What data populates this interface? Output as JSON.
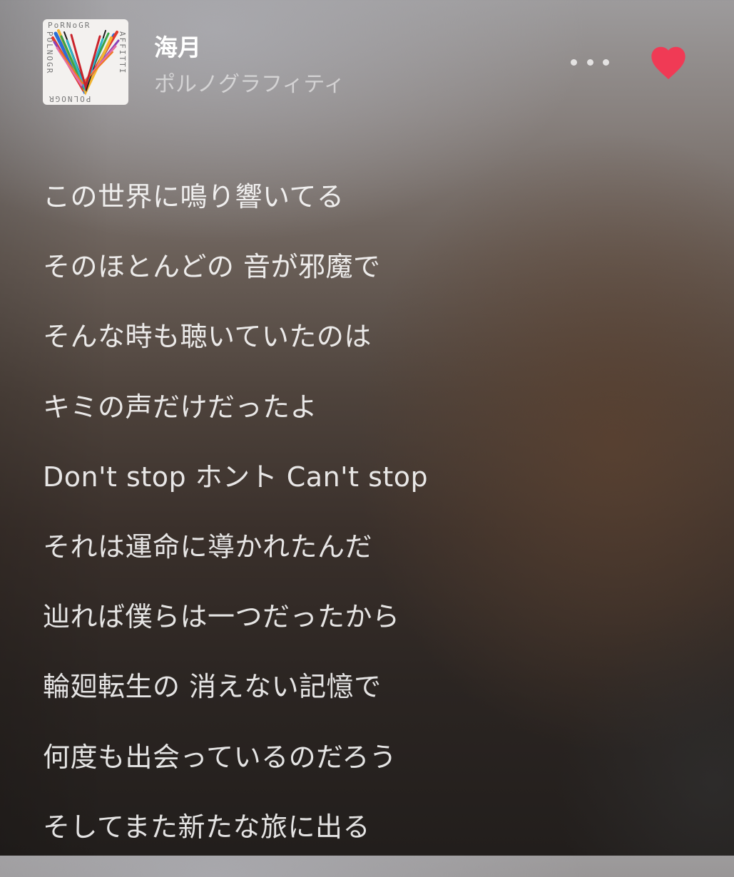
{
  "track": {
    "title": "海月",
    "artist": "ポルノグラフィティ",
    "album_art_icon": "album-art-porno-graffitti",
    "album_art_letters": {
      "top": "PoRNoGR",
      "side_left": "POLNOGR",
      "side_right": "AFFITTI",
      "bottom": "POLNOGR"
    }
  },
  "actions": {
    "more_icon": "more-horizontal-icon",
    "like_icon": "heart-icon",
    "like_color": "#f03a55",
    "liked": true
  },
  "lyrics": [
    "この世界に鳴り響いてる",
    "そのほとんどの 音が邪魔で",
    "そんな時も聴いていたのは",
    "キミの声だけだったよ",
    "Don't stop ホント Can't stop",
    "それは運命に導かれたんだ",
    "辿れば僕らは一つだったから",
    "輪廻転生の 消えない記憶で",
    "何度も出会っているのだろう",
    "そしてまた新たな旅に出る"
  ]
}
